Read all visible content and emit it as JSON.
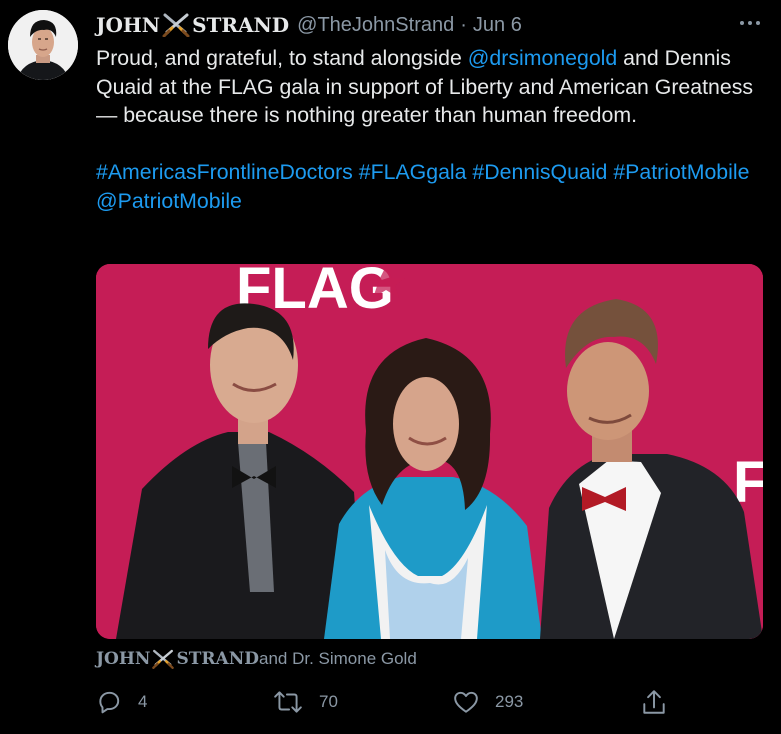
{
  "author": {
    "name_part1": "JOHN",
    "name_part2": "STRAND",
    "handle": "@TheJohnStrand",
    "separator": "·",
    "date": "Jun 6"
  },
  "tweet": {
    "line1_a": "Proud, and grateful, to stand alongside ",
    "mention_1": "@drsimonegold",
    "line1_b": " and Dennis Quaid at the FLAG gala in support of Liberty and American Greatness — because there is nothing greater than human freedom.",
    "hashtags": [
      "#AmericasFrontlineDoctors",
      "#FLAGgala",
      "#DennisQuaid",
      "#PatriotMobile"
    ],
    "mention_2": "@PatriotMobile"
  },
  "media": {
    "banner_text": "FLAG",
    "banner_right_letter": "F",
    "background_color": "#c51d56"
  },
  "tagged": {
    "name_part1": "JOHN",
    "name_part2": "STRAND",
    "suffix": " and Dr. Simone Gold"
  },
  "actions": {
    "reply_count": "4",
    "retweet_count": "70",
    "like_count": "293"
  },
  "icons": {
    "more": "more-dots-icon",
    "reply": "reply-icon",
    "retweet": "retweet-icon",
    "like": "heart-icon",
    "share": "share-icon",
    "name_emoji": "crossed-swords-icon"
  },
  "colors": {
    "link": "#1d9bf0",
    "muted": "#8b98a5",
    "text": "#e7e9ea",
    "background": "#000000"
  }
}
